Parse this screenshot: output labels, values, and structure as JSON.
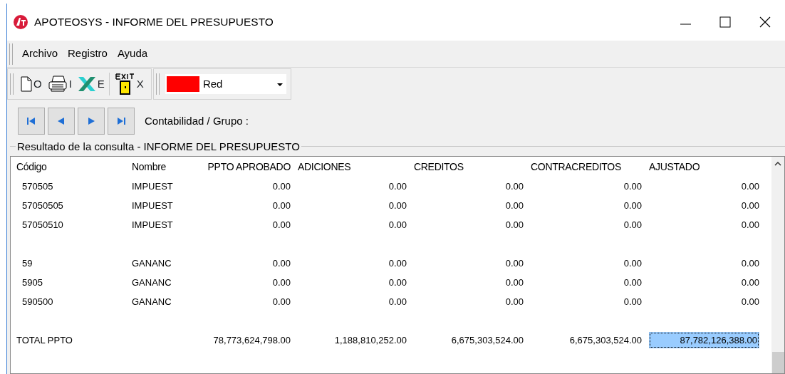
{
  "window": {
    "title": "APOTEOSYS - INFORME DEL PRESUPUESTO"
  },
  "menu": [
    "Archivo",
    "Registro",
    "Ayuda"
  ],
  "toolbar": [
    {
      "kind": "new",
      "label": "O"
    },
    {
      "kind": "print",
      "label": "I"
    },
    {
      "kind": "excel",
      "label": "E"
    },
    {
      "kind": "exit",
      "label": "X"
    }
  ],
  "color_combo": {
    "value": "Red",
    "color": "#ff0000"
  },
  "navigation": {
    "label": "Contabilidad / Grupo :"
  },
  "group": {
    "title": "Resultado de la consulta - INFORME DEL PRESUPUESTO"
  },
  "table": {
    "columns": [
      "Código",
      "Nombre",
      "PPTO APROBADO",
      "ADICIONES",
      "CREDITOS",
      "CONTRACREDITOS",
      "AJUSTADO"
    ],
    "rows": [
      {
        "kind": "account",
        "code": "570505",
        "name": "IMPUEST",
        "values": [
          "0.00",
          "0.00",
          "0.00",
          "0.00",
          "0.00"
        ],
        "selected_cells": [
          false,
          false,
          false,
          false,
          false
        ]
      },
      {
        "kind": "account",
        "code": "57050505",
        "name": "IMPUEST",
        "values": [
          "0.00",
          "0.00",
          "0.00",
          "0.00",
          "0.00"
        ],
        "selected_cells": [
          false,
          false,
          false,
          false,
          false
        ]
      },
      {
        "kind": "account",
        "code": "57050510",
        "name": "IMPUEST",
        "values": [
          "0.00",
          "0.00",
          "0.00",
          "0.00",
          "0.00"
        ],
        "selected_cells": [
          false,
          false,
          false,
          false,
          false
        ]
      },
      {
        "kind": "blank"
      },
      {
        "kind": "account",
        "code": "59",
        "name": "GANANC",
        "values": [
          "0.00",
          "0.00",
          "0.00",
          "0.00",
          "0.00"
        ],
        "selected_cells": [
          false,
          false,
          false,
          false,
          false
        ]
      },
      {
        "kind": "account",
        "code": "5905",
        "name": "GANANC",
        "values": [
          "0.00",
          "0.00",
          "0.00",
          "0.00",
          "0.00"
        ],
        "selected_cells": [
          false,
          false,
          false,
          false,
          false
        ]
      },
      {
        "kind": "account",
        "code": "590500",
        "name": "GANANC",
        "values": [
          "0.00",
          "0.00",
          "0.00",
          "0.00",
          "0.00"
        ],
        "selected_cells": [
          false,
          false,
          false,
          false,
          false
        ]
      },
      {
        "kind": "blank"
      },
      {
        "kind": "total",
        "code": "TOTAL PPTO",
        "values": [
          "78,773,624,798.00",
          "1,188,810,252.00",
          "6,675,303,524.00",
          "6,675,303,524.00",
          "87,782,126,388.00"
        ],
        "selected_cells": [
          false,
          false,
          false,
          false,
          true
        ]
      }
    ]
  }
}
